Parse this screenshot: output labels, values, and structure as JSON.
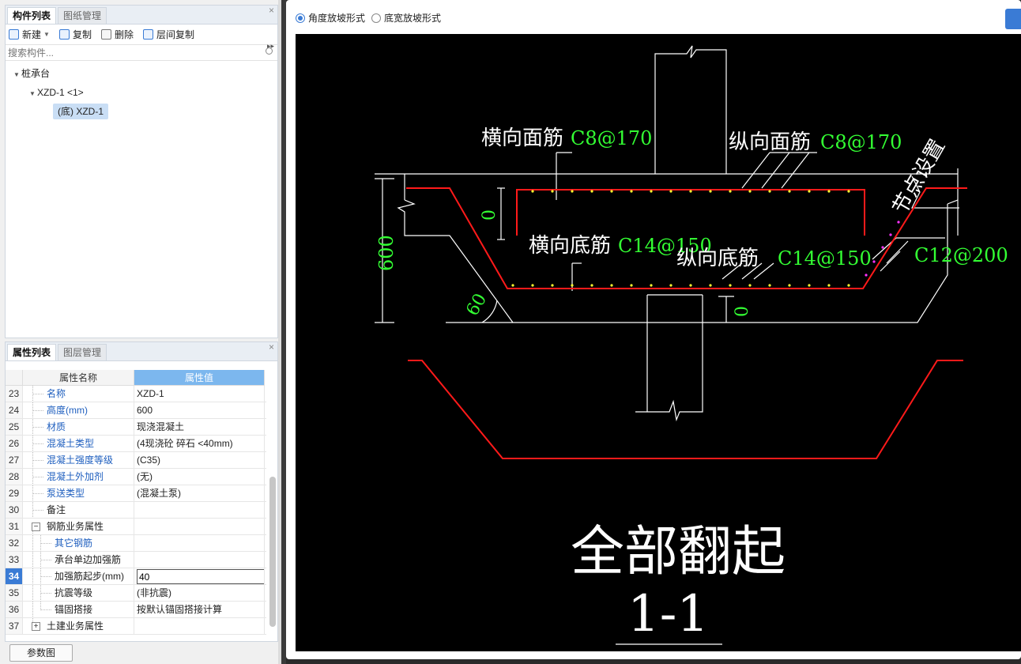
{
  "component_panel": {
    "tabs": [
      "构件列表",
      "图纸管理"
    ],
    "toolbar": {
      "new": "新建",
      "copy": "复制",
      "delete": "删除",
      "floor_copy": "层间复制"
    },
    "search_placeholder": "搜索构件...",
    "tree": {
      "root": "桩承台",
      "child": "XZD-1 <1>",
      "leaf": "(底) XZD-1"
    }
  },
  "property_panel": {
    "tabs": [
      "属性列表",
      "图层管理"
    ],
    "header": {
      "name": "属性名称",
      "value": "属性值"
    },
    "rows": [
      {
        "num": "23",
        "name": "名称",
        "value": "XZD-1"
      },
      {
        "num": "24",
        "name": "高度(mm)",
        "value": "600"
      },
      {
        "num": "25",
        "name": "材质",
        "value": "现浇混凝土"
      },
      {
        "num": "26",
        "name": "混凝土类型",
        "value": "(4现浇砼 碎石 <40mm)"
      },
      {
        "num": "27",
        "name": "混凝土强度等级",
        "value": "(C35)"
      },
      {
        "num": "28",
        "name": "混凝土外加剂",
        "value": "(无)"
      },
      {
        "num": "29",
        "name": "泵送类型",
        "value": "(混凝土泵)"
      },
      {
        "num": "30",
        "name": "备注",
        "value": ""
      },
      {
        "num": "31",
        "name": "钢筋业务属性",
        "value": ""
      },
      {
        "num": "32",
        "name": "其它钢筋",
        "value": ""
      },
      {
        "num": "33",
        "name": "承台单边加强筋",
        "value": ""
      },
      {
        "num": "34",
        "name": "加强筋起步(mm)",
        "value": "40"
      },
      {
        "num": "35",
        "name": "抗震等级",
        "value": "(非抗震)"
      },
      {
        "num": "36",
        "name": "锚固搭接",
        "value": "按默认锚固搭接计算"
      },
      {
        "num": "37",
        "name": "土建业务属性",
        "value": ""
      }
    ],
    "footer_button": "参数图"
  },
  "dialog": {
    "radio_options": [
      "角度放坡形式",
      "底宽放坡形式"
    ],
    "selected_radio": "角度放坡形式"
  },
  "drawing": {
    "label_top_transverse": "横向面筋",
    "val_top_transverse": "C8@170",
    "label_top_longitudinal": "纵向面筋",
    "val_top_longitudinal": "C8@170",
    "label_node": "节点设置",
    "label_bot_transverse": "横向底筋",
    "val_bot_transverse": "C14@150",
    "label_bot_longitudinal": "纵向底筋",
    "val_bot_longitudinal": "C14@150",
    "val_side": "C12@200",
    "dim_height": "600",
    "dim_angle": "60",
    "dim_zero_a": "0",
    "dim_zero_b": "0",
    "caption": "全部翻起",
    "section": "1-1",
    "colors": {
      "bg": "#000000",
      "line": "#ffffff",
      "rebar": "#ff1a1a",
      "text_green": "#33ff33",
      "dot": "#ffff33",
      "dot_side": "#ff33ff"
    }
  }
}
